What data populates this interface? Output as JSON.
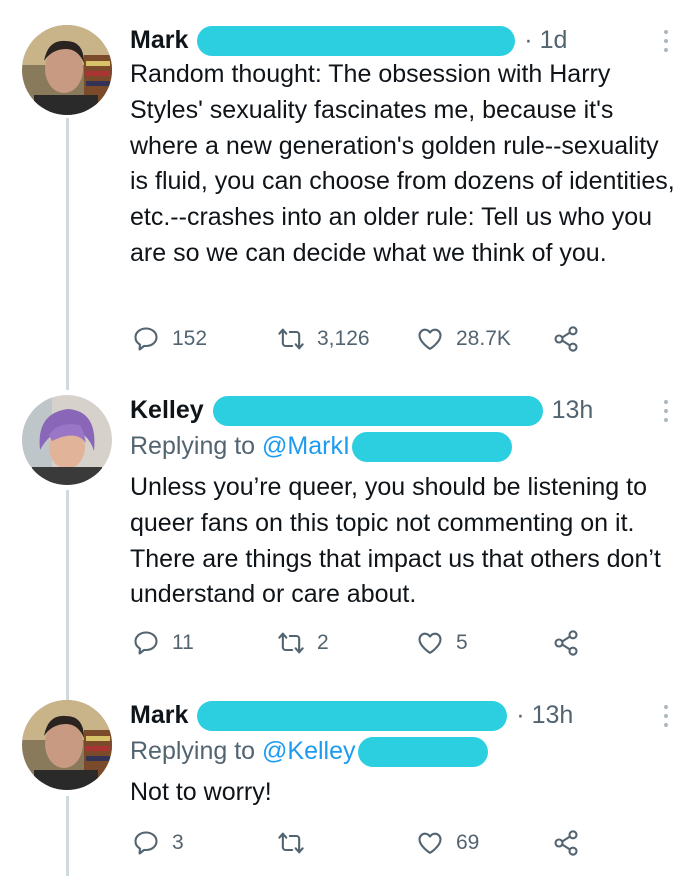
{
  "tweets": [
    {
      "name": "Mark",
      "time": "1d",
      "text": "Random thought: The obsession with Harry Styles' sexuality fascinates me, because it's where a new generation's golden rule--sexuality is fluid, you can choose from dozens of identities, etc.--crashes into an older rule: Tell us who you are so we can decide what we think of you.",
      "replies": "152",
      "retweets": "3,126",
      "likes": "28.7K"
    },
    {
      "name": "Kelley",
      "time": "13h",
      "replying_prefix": "Replying to ",
      "replying_handle": "@MarkI",
      "text": "Unless you’re queer, you should be listening to queer fans on this topic not commenting on it.  There are things that impact us that others don’t understand or care about.",
      "replies": "11",
      "retweets": "2",
      "likes": "5"
    },
    {
      "name": "Mark",
      "time": "13h",
      "replying_prefix": "Replying to ",
      "replying_handle": "@Kelley",
      "text": "Not to worry!",
      "replies": "3",
      "retweets": "",
      "likes": "69"
    }
  ],
  "colors": {
    "redaction": "#2ccfe0",
    "link": "#1d9bf0",
    "muted": "#536471",
    "thread": "#cfd9de"
  },
  "icons": {
    "reply": "reply-bubble-icon",
    "retweet": "retweet-icon",
    "like": "heart-icon",
    "share": "share-icon",
    "more": "more-dots-icon"
  }
}
